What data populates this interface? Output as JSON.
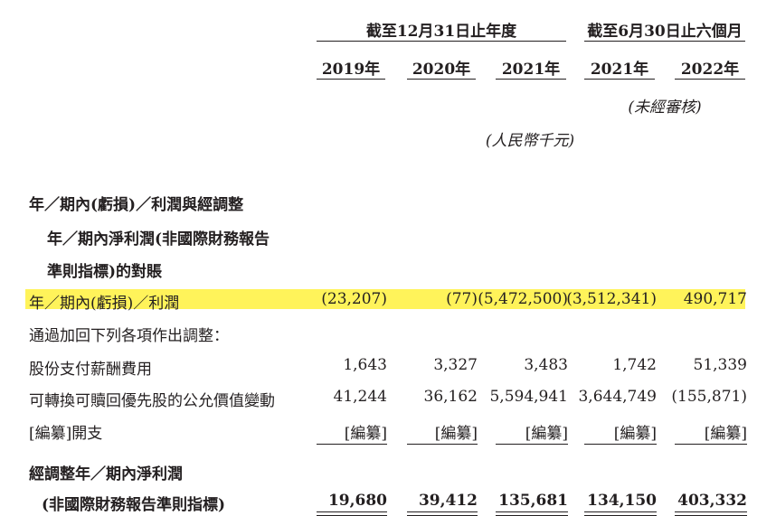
{
  "header": {
    "group_left": "截至12月31日止年度",
    "group_right": "截至6月30日止六個月",
    "years": [
      "2019年",
      "2020年",
      "2021年",
      "2021年",
      "2022年"
    ],
    "unaudited": "(未經審核)",
    "unit": "(人民幣千元)"
  },
  "section": {
    "title": "年／期內(虧損)／利潤與經調整",
    "subtitle_line1": "年／期內淨利潤(非國際財務報告",
    "subtitle_line2": "準則指標)的對賬"
  },
  "rows": [
    {
      "label": "年／期內(虧損)／利潤",
      "values": [
        "(23,207)",
        "(77)",
        "(5,472,500)",
        "(3,512,341)",
        "490,717"
      ]
    },
    {
      "label": "通過加回下列各項作出調整：",
      "values": []
    },
    {
      "label": "股份支付薪酬費用",
      "values": [
        "1,643",
        "3,327",
        "3,483",
        "1,742",
        "51,339"
      ]
    },
    {
      "label": "可轉換可贖回優先股的公允價值變動",
      "values": [
        "41,244",
        "36,162",
        "5,594,941",
        "3,644,749",
        "(155,871)"
      ]
    },
    {
      "label": "[編纂]開支",
      "values": [
        "[編纂]",
        "[編纂]",
        "[編纂]",
        "[編纂]",
        "[編纂]"
      ]
    }
  ],
  "total": {
    "label_line1": "經調整年／期內淨利潤",
    "label_line2": "(非國際財務報告準則指標)",
    "values": [
      "19,680",
      "39,412",
      "135,681",
      "134,150",
      "403,332"
    ]
  },
  "colors": {
    "highlight": "#fff35a",
    "text": "#231f20"
  }
}
